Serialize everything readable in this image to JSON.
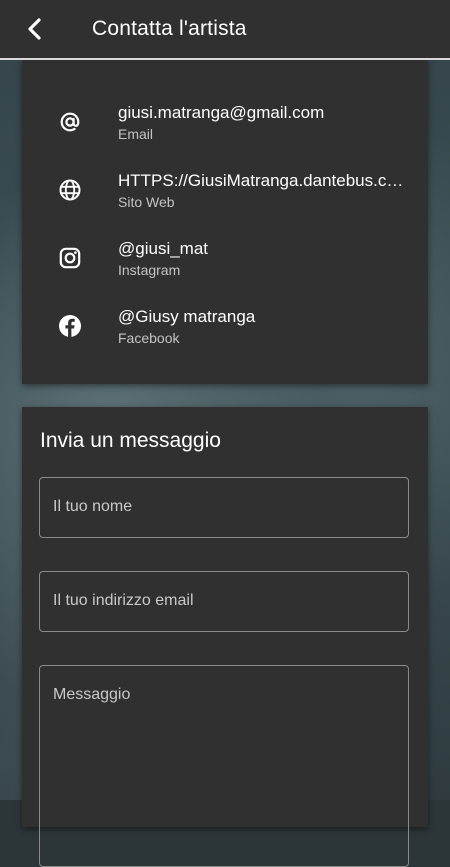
{
  "header": {
    "title": "Contatta l'artista",
    "back_icon": "chevron-left-icon"
  },
  "contacts": [
    {
      "icon": "at-sign-icon",
      "value": "giusi.matranga@gmail.com",
      "label": "Email"
    },
    {
      "icon": "globe-icon",
      "value": "HTTPS://GiusiMatranga.dantebus.com",
      "label": "Sito Web"
    },
    {
      "icon": "instagram-icon",
      "value": "@giusi_mat",
      "label": "Instagram"
    },
    {
      "icon": "facebook-icon",
      "value": "@Giusy matranga",
      "label": "Facebook"
    }
  ],
  "form": {
    "title": "Invia un messaggio",
    "name_placeholder": "Il tuo nome",
    "email_placeholder": "Il tuo indirizzo email",
    "message_placeholder": "Messaggio"
  },
  "colors": {
    "appbar": "#303030",
    "card": "#303030",
    "text": "#ffffff",
    "subtext": "#c4c4c4",
    "border": "#8a8a8a"
  }
}
